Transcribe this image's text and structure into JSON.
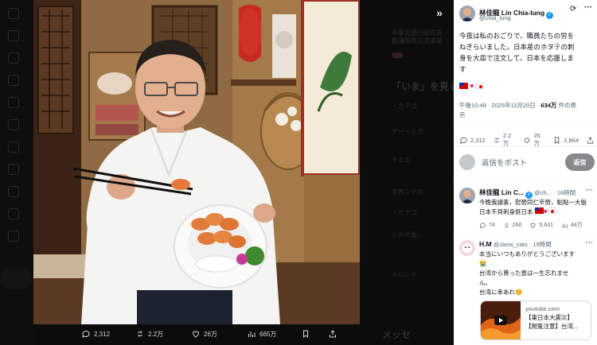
{
  "background_left": {
    "icons": [
      "x-logo-icon",
      "home-icon",
      "search-icon",
      "bell-icon",
      "mail-icon",
      "grok-icon",
      "bookmark-icon",
      "people-icon",
      "premium-icon",
      "profile-icon",
      "more-icon"
    ]
  },
  "background_right": {
    "faded_texts": [
      "中華民國行政院長",
      "擬議國際交流事業",
      "「いま」を見る",
      "・カテゴ",
      "ゲー・ミク",
      "ナミエ",
      "世界ンドの",
      "・カテゴ",
      "シル大量...",
      "トレンド",
      "メッセ"
    ]
  },
  "expand_label": "»",
  "photo_actions": {
    "replies": "2,312",
    "reposts": "2.2万",
    "likes": "26万",
    "views": "665万"
  },
  "post": {
    "author_name": "林佳龍 Lin Chia-lung",
    "author_handle": "@chia_lung",
    "text_lines": [
      "今夜は私のおごりで、職員たちの労を",
      "ねぎらいました。日本産のホタテの刺",
      "身を大皿で注文して、日本を応援しま",
      "す"
    ],
    "time": "午後10:49 · 2025年11月20日 · ",
    "views_count": "634万",
    "views_suffix": " 件の表",
    "views_suffix2": "示",
    "stats": {
      "replies": "2,312",
      "reposts": "2.2万",
      "likes": "26万",
      "bookmarks": "2,864"
    }
  },
  "reply_box": {
    "placeholder": "返信をポスト",
    "button": "返信"
  },
  "replies": [
    {
      "name": "林佳龍 Lin C...",
      "handle": "@ch...",
      "time": "· 16時間",
      "text": "今晚我請客，慰勞同仁辛勞，點點一大盤日本干貝刺身挺日本",
      "stats": {
        "replies": "74",
        "reposts": "260",
        "likes": "5,631",
        "views": "44万"
      }
    },
    {
      "name": "H.M",
      "handle": "@Janis_cats",
      "time": "· 15時間",
      "text_lines": [
        "本当にいつもありがとうございます",
        "😭",
        "台湾から貰った恩は一生忘れませ",
        "ん。",
        "台湾に幸あれ☺️"
      ]
    }
  ],
  "card": {
    "domain": "youtube.com",
    "title1": "【東日本大震災】",
    "title2": "【閲覧注意】台湾..."
  }
}
